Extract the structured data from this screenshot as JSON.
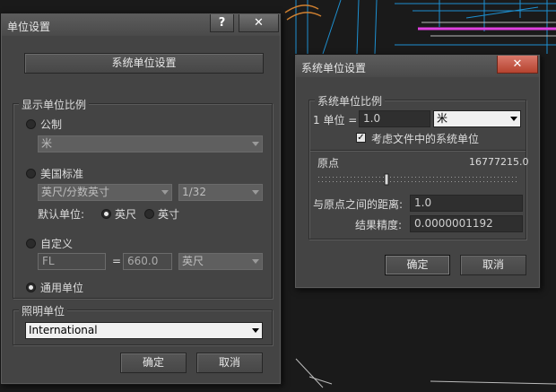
{
  "unit_setup": {
    "title": "单位设置",
    "help_glyph": "?",
    "close_glyph": "✕",
    "system_unit_button": "系统单位设置",
    "display_scale": {
      "title": "显示单位比例",
      "metric": {
        "label": "公制",
        "value": "米"
      },
      "us_standard": {
        "label": "美国标准",
        "unit": "英尺/分数英寸",
        "fraction": "1/32",
        "default_unit_label": "默认单位:",
        "feet_label": "英尺",
        "inches_label": "英寸"
      },
      "custom": {
        "label": "自定义",
        "name_value": "FL",
        "equals": "=",
        "amount_value": "660.0",
        "unit_value": "英尺"
      },
      "generic": {
        "label": "通用单位"
      }
    },
    "lighting": {
      "title": "照明单位",
      "value": "International"
    },
    "ok": "确定",
    "cancel": "取消"
  },
  "system_unit_setup": {
    "title": "系统单位设置",
    "close_glyph": "✕",
    "scale": {
      "title": "系统单位比例",
      "prefix": "1 单位 =",
      "value": "1.0",
      "unit": "米",
      "respect_label": "考虑文件中的系统单位"
    },
    "origin": {
      "label": "原点",
      "value": "16777215.0",
      "distance_label": "与原点之间的距离:",
      "distance_value": "1.0",
      "precision_label": "结果精度:",
      "precision_value": "0.0000001192"
    },
    "ok": "确定",
    "cancel": "取消"
  }
}
